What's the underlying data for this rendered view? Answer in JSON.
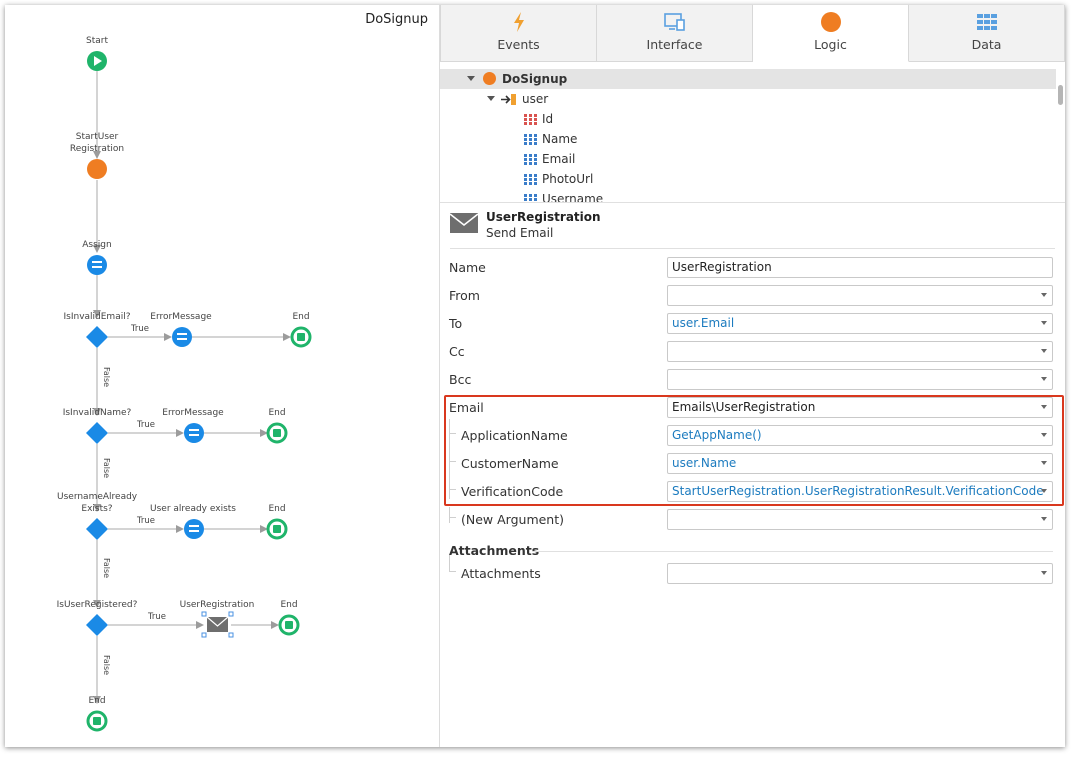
{
  "flow": {
    "title": "DoSignup",
    "nodes": {
      "start": "Start",
      "start_user_reg": "StartUser Registration",
      "assign": "Assign",
      "if1": "IsInvalidEmail?",
      "if1_action": "ErrorMessage",
      "if1_end": "End",
      "if2": "IsInvalidName?",
      "if2_action": "ErrorMessage",
      "if2_end": "End",
      "if3": "UsernameAlready Exists?",
      "if3_action": "User already exists",
      "if3_end": "End",
      "if4": "IsUserRegistered?",
      "if4_action": "UserRegistration",
      "if4_end": "End",
      "final_end": "End"
    },
    "true_label": "True",
    "false_label": "False"
  },
  "tabs": [
    {
      "label": "Events",
      "icon": "lightning-icon",
      "active": false
    },
    {
      "label": "Interface",
      "icon": "screen-icon",
      "active": false
    },
    {
      "label": "Logic",
      "icon": "logic-circle-icon",
      "active": true
    },
    {
      "label": "Data",
      "icon": "table-icon",
      "active": false
    }
  ],
  "tree": {
    "root": "DoSignup",
    "param": "user",
    "attributes": [
      "Id",
      "Name",
      "Email",
      "PhotoUrl",
      "Username"
    ]
  },
  "properties": {
    "element_name": "UserRegistration",
    "element_type": "Send Email",
    "rows": {
      "name": {
        "label": "Name",
        "value": "UserRegistration"
      },
      "from": {
        "label": "From",
        "value": ""
      },
      "to": {
        "label": "To",
        "value": "user.Email"
      },
      "cc": {
        "label": "Cc",
        "value": ""
      },
      "bcc": {
        "label": "Bcc",
        "value": ""
      },
      "email": {
        "label": "Email",
        "value": "Emails\\UserRegistration"
      },
      "app_name": {
        "label": "ApplicationName",
        "value": "GetAppName()"
      },
      "customer_name": {
        "label": "CustomerName",
        "value": "user.Name"
      },
      "verification_code": {
        "label": "VerificationCode",
        "value": "StartUserRegistration.UserRegistrationResult.VerificationCode"
      },
      "new_argument": {
        "label": "(New Argument)",
        "value": ""
      }
    },
    "attachments_section": "Attachments",
    "attachments": {
      "label": "Attachments",
      "value": ""
    }
  },
  "colors": {
    "start_green": "#1fb46a",
    "end_green": "#1fb46a",
    "orange": "#ef7d22",
    "blue": "#1a8ae6",
    "highlight_red": "#d9381e",
    "value_blue": "#1c7bbf"
  }
}
